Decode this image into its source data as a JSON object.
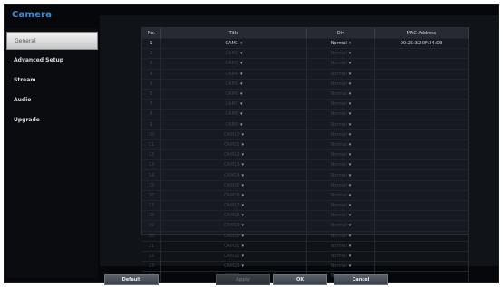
{
  "window": {
    "title": "Camera"
  },
  "sidebar": {
    "items": [
      {
        "label": "General"
      },
      {
        "label": "Advanced Setup"
      },
      {
        "label": "Stream"
      },
      {
        "label": "Audio"
      },
      {
        "label": "Upgrade"
      }
    ]
  },
  "table": {
    "columns": [
      "No.",
      "Title",
      "Div",
      "MAC Address"
    ],
    "rows": [
      {
        "no": "1",
        "title": "CAM1",
        "div": "Normal",
        "mac": "00:25:32:0F:24:D3"
      },
      {
        "no": "2",
        "title": "CAM2",
        "div": "Normal",
        "mac": ""
      },
      {
        "no": "3",
        "title": "CAM3",
        "div": "Normal",
        "mac": ""
      },
      {
        "no": "4",
        "title": "CAM4",
        "div": "Normal",
        "mac": ""
      },
      {
        "no": "5",
        "title": "CAM5",
        "div": "Normal",
        "mac": ""
      },
      {
        "no": "6",
        "title": "CAM6",
        "div": "Normal",
        "mac": ""
      },
      {
        "no": "7",
        "title": "CAM7",
        "div": "Normal",
        "mac": ""
      },
      {
        "no": "8",
        "title": "CAM8",
        "div": "Normal",
        "mac": ""
      },
      {
        "no": "9",
        "title": "CAM9",
        "div": "Normal",
        "mac": ""
      },
      {
        "no": "10",
        "title": "CAM10",
        "div": "Normal",
        "mac": ""
      },
      {
        "no": "11",
        "title": "CAM11",
        "div": "Normal",
        "mac": ""
      },
      {
        "no": "12",
        "title": "CAM12",
        "div": "Normal",
        "mac": ""
      },
      {
        "no": "13",
        "title": "CAM13",
        "div": "Normal",
        "mac": ""
      },
      {
        "no": "14",
        "title": "CAM14",
        "div": "Normal",
        "mac": ""
      },
      {
        "no": "15",
        "title": "CAM15",
        "div": "Normal",
        "mac": ""
      },
      {
        "no": "16",
        "title": "CAM16",
        "div": "Normal",
        "mac": ""
      },
      {
        "no": "17",
        "title": "CAM17",
        "div": "Normal",
        "mac": ""
      },
      {
        "no": "18",
        "title": "CAM18",
        "div": "Normal",
        "mac": ""
      },
      {
        "no": "19",
        "title": "CAM19",
        "div": "Normal",
        "mac": ""
      },
      {
        "no": "20",
        "title": "CAM20",
        "div": "Normal",
        "mac": ""
      },
      {
        "no": "21",
        "title": "CAM21",
        "div": "Normal",
        "mac": ""
      },
      {
        "no": "22",
        "title": "CAM22",
        "div": "Normal",
        "mac": ""
      },
      {
        "no": "23",
        "title": "CAM23",
        "div": "Normal",
        "mac": ""
      },
      {
        "no": "24",
        "title": "CAM24",
        "div": "Normal",
        "mac": ""
      }
    ]
  },
  "buttons": {
    "default": "Default",
    "apply": "Apply",
    "ok": "OK",
    "cancel": "Cancel"
  }
}
